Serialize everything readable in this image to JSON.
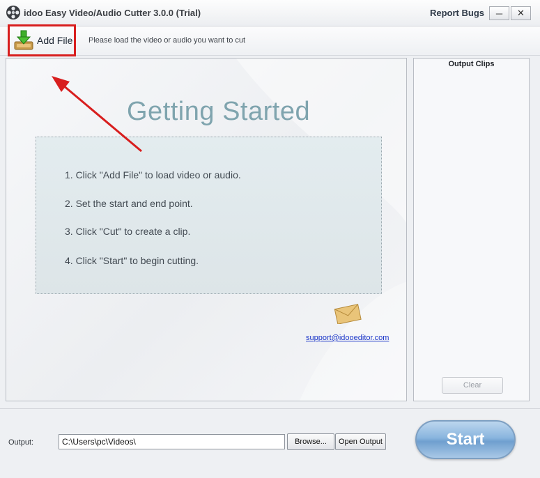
{
  "window": {
    "title": "idoo Easy Video/Audio Cutter 3.0.0 (Trial)",
    "report_bugs": "Report Bugs",
    "minimize_glyph": "─",
    "close_glyph": "✕"
  },
  "toolbar": {
    "add_file_label": "Add File",
    "hint": "Please load the video or audio you want to cut"
  },
  "main": {
    "heading": "Getting Started",
    "steps": [
      "1. Click \"Add File\" to load video or audio.",
      "2. Set the start and end point.",
      "3. Click \"Cut\" to create a clip.",
      "4. Click \"Start\" to begin cutting."
    ],
    "support_email": "support@idooeditor.com"
  },
  "clips": {
    "title": "Output Clips",
    "clear_label": "Clear"
  },
  "bottom": {
    "output_label": "Output:",
    "output_path": "C:\\Users\\pc\\Videos\\",
    "browse_label": "Browse...",
    "open_output_label": "Open Output",
    "start_label": "Start"
  },
  "icons": {
    "app_logo": "film-reel-icon",
    "add_file": "download-arrow-icon",
    "mail": "envelope-icon"
  },
  "colors": {
    "highlight_border": "#d81e1e",
    "annotation_arrow": "#d81e1e",
    "heading": "#7fa4ae",
    "link": "#1a35c8"
  }
}
